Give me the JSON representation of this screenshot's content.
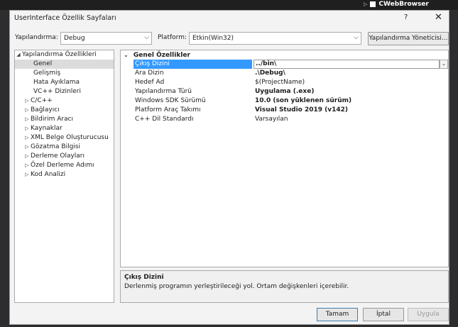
{
  "background_app": {
    "title": "CWebBrowser"
  },
  "dialog": {
    "title": "UserInterface Özellik Sayfaları",
    "help": "?",
    "close": "✕"
  },
  "toolbar": {
    "config_label": "Yapılandırma:",
    "config_value": "Debug",
    "platform_label": "Platform:",
    "platform_value": "Etkin(Win32)",
    "manager_button": "Yapılandırma Yöneticisi..."
  },
  "tree": {
    "root": "Yapılandırma Özellikleri",
    "items": [
      {
        "label": "Genel",
        "expandable": false,
        "selected": true
      },
      {
        "label": "Gelişmiş",
        "expandable": false
      },
      {
        "label": "Hata Ayıklama",
        "expandable": false
      },
      {
        "label": "VC++ Dizinleri",
        "expandable": false
      },
      {
        "label": "C/C++",
        "expandable": true
      },
      {
        "label": "Bağlayıcı",
        "expandable": true
      },
      {
        "label": "Bildirim Aracı",
        "expandable": true
      },
      {
        "label": "Kaynaklar",
        "expandable": true
      },
      {
        "label": "XML Belge Oluşturucusu",
        "expandable": true
      },
      {
        "label": "Gözatma Bilgisi",
        "expandable": true
      },
      {
        "label": "Derleme Olayları",
        "expandable": true
      },
      {
        "label": "Özel Derleme Adımı",
        "expandable": true
      },
      {
        "label": "Kod Analizi",
        "expandable": true
      }
    ]
  },
  "grid": {
    "category": "Genel Özellikler",
    "rows": [
      {
        "name": "Çıkış Dizini",
        "value": "../bin\\",
        "bold": true,
        "selected": true
      },
      {
        "name": "Ara Dizin",
        "value": ".\\Debug\\",
        "bold": true
      },
      {
        "name": "Hedef Ad",
        "value": "$(ProjectName)",
        "bold": false
      },
      {
        "name": "Yapılandırma Türü",
        "value": "Uygulama (.exe)",
        "bold": true
      },
      {
        "name": "Windows SDK Sürümü",
        "value": "10.0 (son yüklenen sürüm)",
        "bold": true
      },
      {
        "name": "Platform Araç Takımı",
        "value": "Visual Studio 2019 (v142)",
        "bold": true
      },
      {
        "name": "C++ Dil Standardı",
        "value": "Varsayılan",
        "bold": false
      }
    ]
  },
  "description": {
    "title": "Çıkış Dizini",
    "text": "Derlenmiş programın yerleştirileceği yol. Ortam değişkenleri içerebilir."
  },
  "buttons": {
    "ok": "Tamam",
    "cancel": "İptal",
    "apply": "Uygula"
  }
}
